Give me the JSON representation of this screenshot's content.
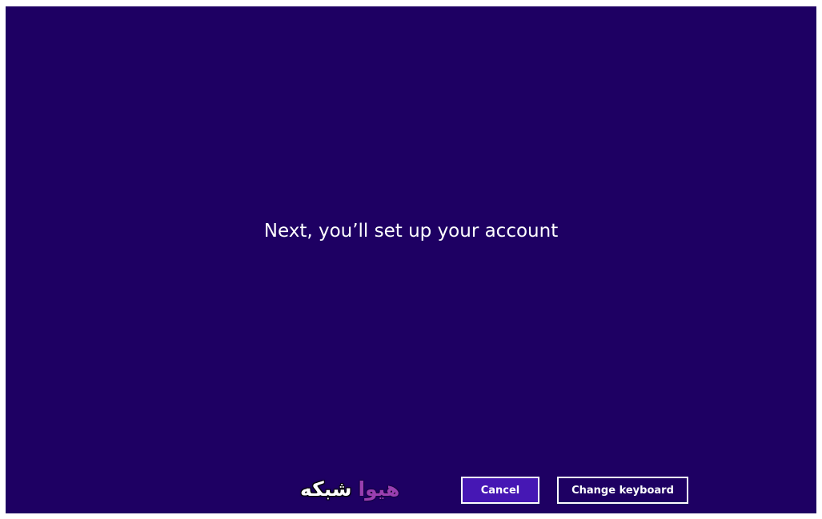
{
  "screen": {
    "background_color": "#1e0063",
    "heading": "Next, you’ll set up your account"
  },
  "footer": {
    "watermark_part1": "هیوا",
    "watermark_part2": "شبکه",
    "cancel_label": "Cancel",
    "change_keyboard_label": "Change keyboard",
    "accent_color": "#4617b4"
  }
}
